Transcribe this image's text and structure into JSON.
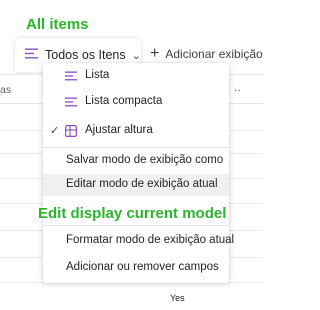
{
  "annotations": {
    "top_label": "All items",
    "mid_label": "Edit display current model"
  },
  "view_bar": {
    "selected_view": "Todos os Itens",
    "add_view_label": "Adicionar exibição"
  },
  "grid": {
    "header_left_fragment": "as",
    "header_right_fragment": "..",
    "cell_value": "Yes"
  },
  "menu": {
    "list_label": "Lista",
    "compact_list_label": "Lista compacta",
    "fit_height_label": "Ajustar altura",
    "save_view_as_label": "Salvar modo de exibição como",
    "edit_view_label": "Editar modo de exibição atual",
    "format_view_label": "Formatar modo de exibição atual",
    "add_remove_columns_label": "Adicionar ou remover campos"
  },
  "colors": {
    "annotation_green": "#2bb52b",
    "icon_purple": "#8a4fc4",
    "hover_gray": "#f0f0f0"
  },
  "icons": {
    "view_icon": "list-lines-icon",
    "check_icon": "checkmark-icon",
    "fit_icon": "table-grid-icon"
  }
}
